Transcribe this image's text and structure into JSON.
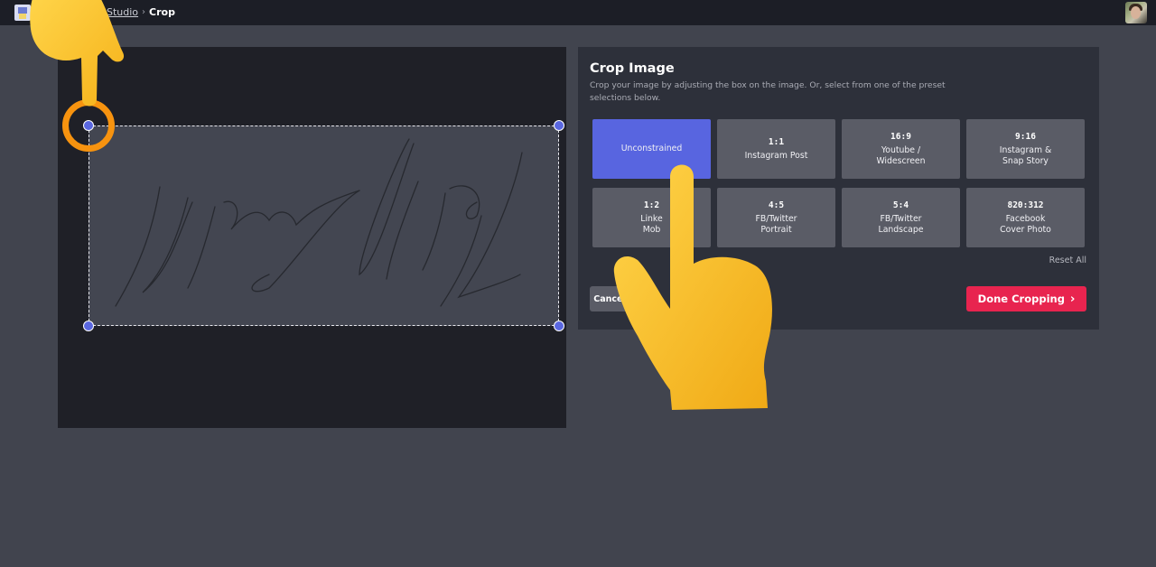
{
  "topbar": {
    "logo": "app-logo",
    "breadcrumb": {
      "link": "Studio",
      "separator": "›",
      "current": "Crop"
    },
    "avatar": "user-avatar"
  },
  "panel": {
    "title": "Crop Image",
    "description": "Crop your image by adjusting the box on the image. Or, select from one of the preset selections below.",
    "presets": [
      {
        "ratio": "",
        "label": "Unconstrained",
        "active": true
      },
      {
        "ratio": "1:1",
        "label": "Instagram Post",
        "active": false
      },
      {
        "ratio": "16:9",
        "label": "Youtube /\nWidescreen",
        "active": false
      },
      {
        "ratio": "9:16",
        "label": "Instagram &\nSnap Story",
        "active": false
      },
      {
        "ratio": "1:2",
        "label": "Linke\nMob",
        "active": false
      },
      {
        "ratio": "4:5",
        "label": "FB/Twitter\nPortrait",
        "active": false
      },
      {
        "ratio": "5:4",
        "label": "FB/Twitter\nLandscape",
        "active": false
      },
      {
        "ratio": "820:312",
        "label": "Facebook\nCover Photo",
        "active": false
      }
    ],
    "reset_label": "Reset All",
    "cancel_label": "Cancel",
    "done_label": "Done Cropping",
    "done_icon": "›"
  },
  "colors": {
    "accent": "#5865e0",
    "primary_button": "#e8244f",
    "highlight_ring": "#f7930f"
  }
}
